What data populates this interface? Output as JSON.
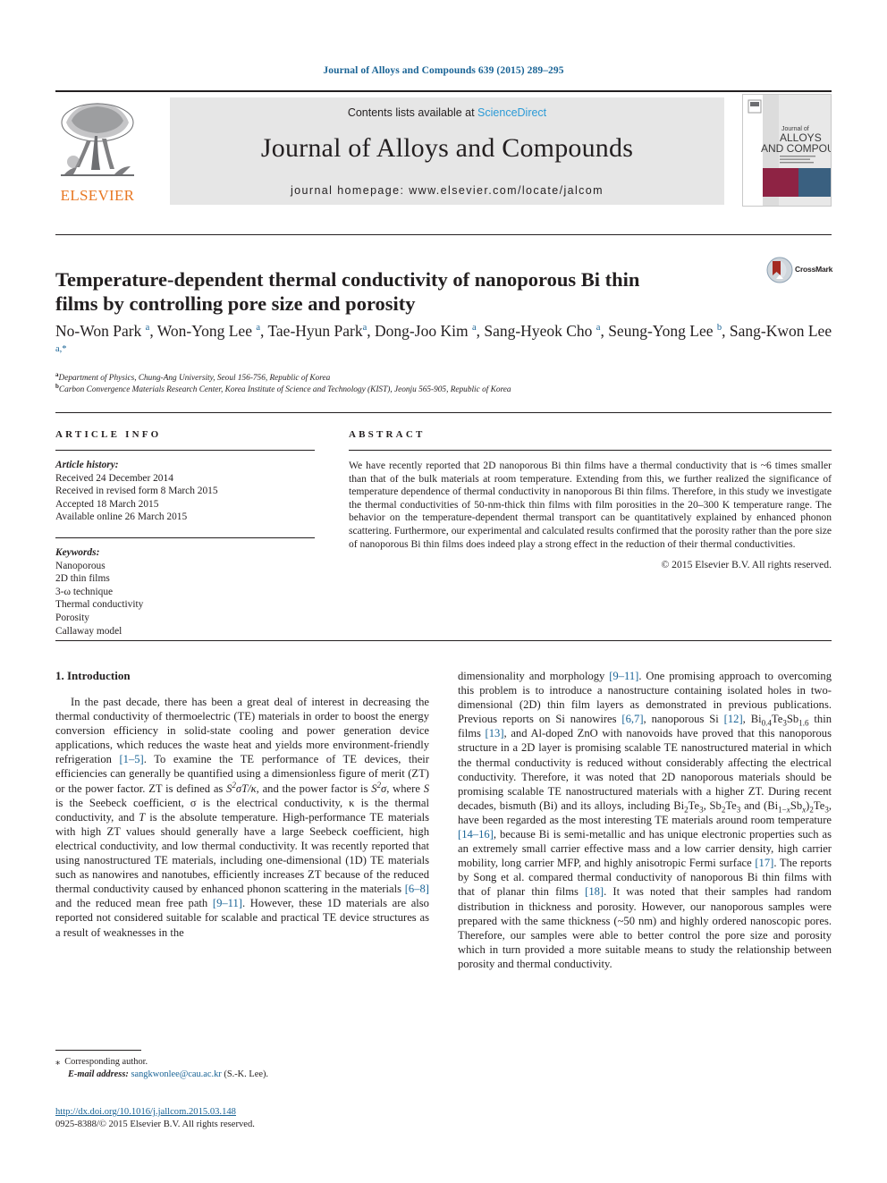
{
  "running_head": "Journal of Alloys and Compounds 639 (2015) 289–295",
  "header": {
    "contents_prefix": "Contents lists available at ",
    "sciencedirect": "ScienceDirect",
    "journal_title": "Journal of Alloys and Compounds",
    "homepage": "journal homepage: www.elsevier.com/locate/jalcom",
    "publisher_name": "ELSEVIER",
    "cover": {
      "line1": "Journal of",
      "line2": "ALLOYS",
      "line3": "AND COMPOUNDS"
    }
  },
  "article": {
    "title": "Temperature-dependent thermal conductivity of nanoporous Bi thin films by controlling pore size and porosity",
    "crossmark_label": "CrossMark",
    "authors_html": "No-Won Park <sup>a</sup>, Won-Yong Lee <sup>a</sup>, Tae-Hyun Park<sup>a</sup>, Dong-Joo Kim <sup>a</sup>, Sang-Hyeok Cho <sup>a</sup>, Seung-Yong Lee <sup>b</sup>, Sang-Kwon Lee <sup>a,*</sup>",
    "affiliation_a": "Department of Physics, Chung-Ang University, Seoul 156-756, Republic of Korea",
    "affiliation_b": "Carbon Convergence Materials Research Center, Korea Institute of Science and Technology (KIST), Jeonju 565-905, Republic of Korea"
  },
  "info": {
    "heading": "ARTICLE INFO",
    "history_label": "Article history:",
    "history": [
      "Received 24 December 2014",
      "Received in revised form 8 March 2015",
      "Accepted 18 March 2015",
      "Available online 26 March 2015"
    ],
    "keywords_label": "Keywords:",
    "keywords": [
      "Nanoporous",
      "2D thin films",
      "3-ω technique",
      "Thermal conductivity",
      "Porosity",
      "Callaway model"
    ]
  },
  "abstract": {
    "heading": "ABSTRACT",
    "text": "We have recently reported that 2D nanoporous Bi thin films have a thermal conductivity that is ~6 times smaller than that of the bulk materials at room temperature. Extending from this, we further realized the significance of temperature dependence of thermal conductivity in nanoporous Bi thin films. Therefore, in this study we investigate the thermal conductivities of 50-nm-thick thin films with film porosities in the 20–300 K temperature range. The behavior on the temperature-dependent thermal transport can be quantitatively explained by enhanced phonon scattering. Furthermore, our experimental and calculated results confirmed that the porosity rather than the pore size of nanoporous Bi thin films does indeed play a strong effect in the reduction of their thermal conductivities.",
    "copyright": "© 2015 Elsevier B.V. All rights reserved."
  },
  "body": {
    "section_title": "1. Introduction",
    "left_paragraph_html": "In the past decade, there has been a great deal of interest in decreasing the thermal conductivity of thermoelectric (TE) materials in order to boost the energy conversion efficiency in solid-state cooling and power generation device applications, which reduces the waste heat and yields more environment-friendly refrigeration <span class=\"ref\">[1–5]</span>. To examine the TE performance of TE devices, their efficiencies can generally be quantified using a dimensionless figure of merit (ZT) or the power factor. ZT is defined as <em class=\"v\">S<sup class=\"sp\">2</sup>σT/κ</em>, and the power factor is <em class=\"v\">S<sup class=\"sp\">2</sup>σ</em>, where <em class=\"v\">S</em> is the Seebeck coefficient, σ is the electrical conductivity, κ is the thermal conductivity, and <em class=\"v\">T</em> is the absolute temperature. High-performance TE materials with high ZT values should generally have a large Seebeck coefficient, high electrical conductivity, and low thermal conductivity. It was recently reported that using nanostructured TE materials, including one-dimensional (1D) TE materials such as nanowires and nanotubes, efficiently increases ZT because of the reduced thermal conductivity caused by enhanced phonon scattering in the materials <span class=\"ref\">[6–8]</span> and the reduced mean free path <span class=\"ref\">[9–11]</span>. However, these 1D materials are also reported not considered suitable for scalable and practical TE device structures as a result of weaknesses in the",
    "right_paragraph_html": "dimensionality and morphology <span class=\"ref\">[9–11]</span>. One promising approach to overcoming this problem is to introduce a nanostructure containing isolated holes in two-dimensional (2D) thin film layers as demonstrated in previous publications. Previous reports on Si nanowires <span class=\"ref\">[6,7]</span>, nanoporous Si <span class=\"ref\">[12]</span>, Bi<sub class=\"sb\">0.4</sub>Te<sub class=\"sb\">3</sub>Sb<sub class=\"sb\">1.6</sub> thin films <span class=\"ref\">[13]</span>, and Al-doped ZnO with nanovoids have proved that this nanoporous structure in a 2D layer is promising scalable TE nanostructured material in which the thermal conductivity is reduced without considerably affecting the electrical conductivity. Therefore, it was noted that 2D nanoporous materials should be promising scalable TE nanostructured materials with a higher ZT. During recent decades, bismuth (Bi) and its alloys, including Bi<sub class=\"sb\">2</sub>Te<sub class=\"sb\">3</sub>, Sb<sub class=\"sb\">2</sub>Te<sub class=\"sb\">3</sub> and (Bi<sub class=\"sb\">1−<em class=\"v\">x</em></sub>Sb<sub class=\"sb\"><em class=\"v\">x</em></sub>)<sub class=\"sb\">2</sub>Te<sub class=\"sb\">3</sub>, have been regarded as the most interesting TE materials around room temperature <span class=\"ref\">[14–16]</span>, because Bi is semi-metallic and has unique electronic properties such as an extremely small carrier effective mass and a low carrier density, high carrier mobility, long carrier MFP, and highly anisotropic Fermi surface <span class=\"ref\">[17]</span>. The reports by Song et al. compared thermal conductivity of nanoporous Bi thin films with that of planar thin films <span class=\"ref\">[18]</span>. It was noted that their samples had random distribution in thickness and porosity. However, our nanoporous samples were prepared with the same thickness (~50 nm) and highly ordered nanoscopic pores. Therefore, our samples were able to better control the pore size and porosity which in turn provided a more suitable means to study the relationship between porosity and thermal conductivity."
  },
  "footer": {
    "corresponding_star": "⁎",
    "corresponding_label": "Corresponding author.",
    "email_label": "E-mail address:",
    "email": "sangkwonlee@cau.ac.kr",
    "email_suffix": "(S.-K. Lee).",
    "doi": "http://dx.doi.org/10.1016/j.jallcom.2015.03.148",
    "issn_copyright": "0925-8388/© 2015 Elsevier B.V. All rights reserved."
  },
  "colors": {
    "link_blue": "#1a6496",
    "sciencedirect_blue": "#2b9ad6",
    "elsevier_orange": "#e87722",
    "cover_maroon": "#8e2344",
    "cover_navy": "#3a6080",
    "header_gray": "#e6e6e6"
  }
}
